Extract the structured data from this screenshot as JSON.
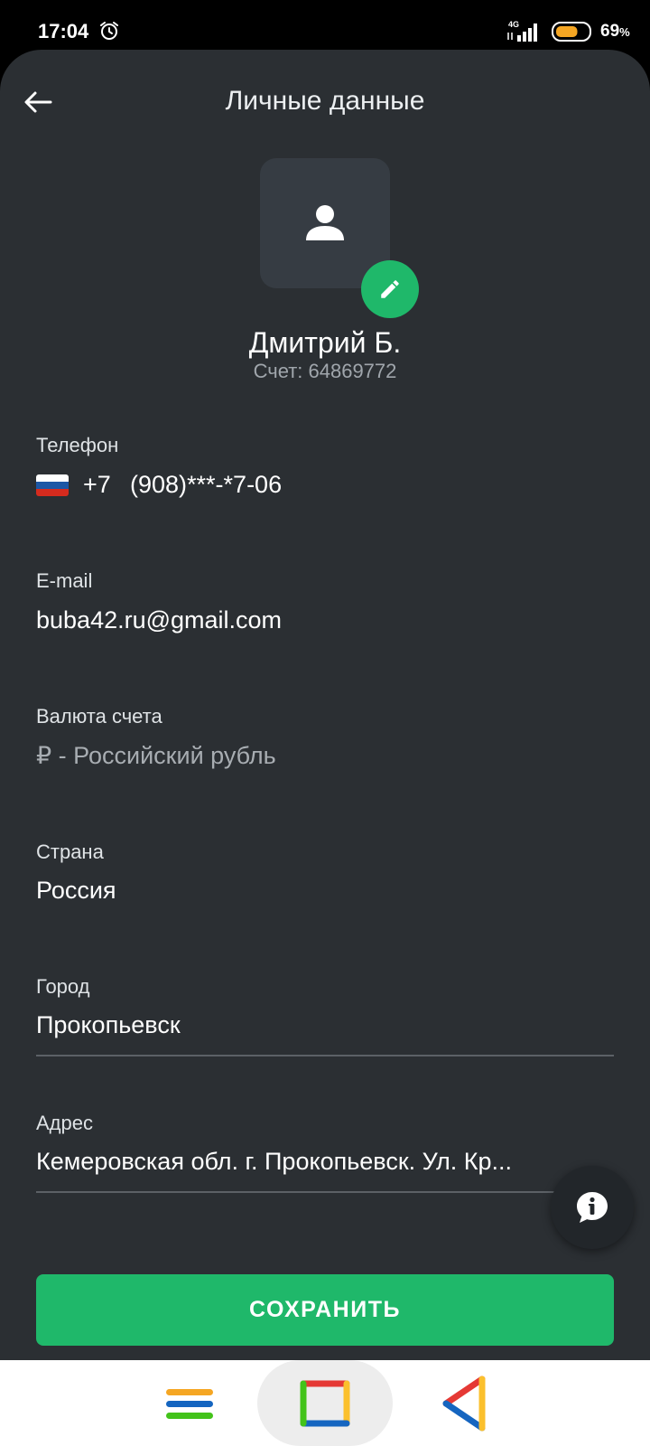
{
  "status_bar": {
    "time": "17:04",
    "network": "4G",
    "battery_percent": "69",
    "battery_unit": "%",
    "battery_level": 0.69,
    "battery_color": "#f5a623"
  },
  "header": {
    "title": "Личные данные",
    "back_icon": "arrow-left-icon"
  },
  "profile": {
    "name": "Дмитрий Б.",
    "account": "Счет: 64869772",
    "avatar_icon": "person-icon",
    "edit_icon": "pencil-icon"
  },
  "fields": {
    "phone": {
      "label": "Телефон",
      "code": "+7",
      "number": "(908)***-*7-06",
      "flag_icon": "russia-flag-icon"
    },
    "email": {
      "label": "E-mail",
      "value": "buba42.ru@gmail.com"
    },
    "currency": {
      "label": "Валюта счета",
      "value": "₽ - Российский рубль"
    },
    "country": {
      "label": "Страна",
      "value": "Россия"
    },
    "city": {
      "label": "Город",
      "value": "Прокопьевск"
    },
    "address": {
      "label": "Адрес",
      "value": "Кемеровская обл. г. Прокопьевск. Ул. Кр..."
    }
  },
  "save_label": "СОХРАНИТЬ",
  "colors": {
    "background": "#2b2f33",
    "accent_green": "#1fb86a",
    "avatar_bg": "#363c43",
    "muted_text": "#a0a6ac"
  },
  "nav_bar": {
    "menu_icon": "menu-icon",
    "home_icon": "home-square-icon",
    "back_icon": "back-triangle-icon"
  }
}
